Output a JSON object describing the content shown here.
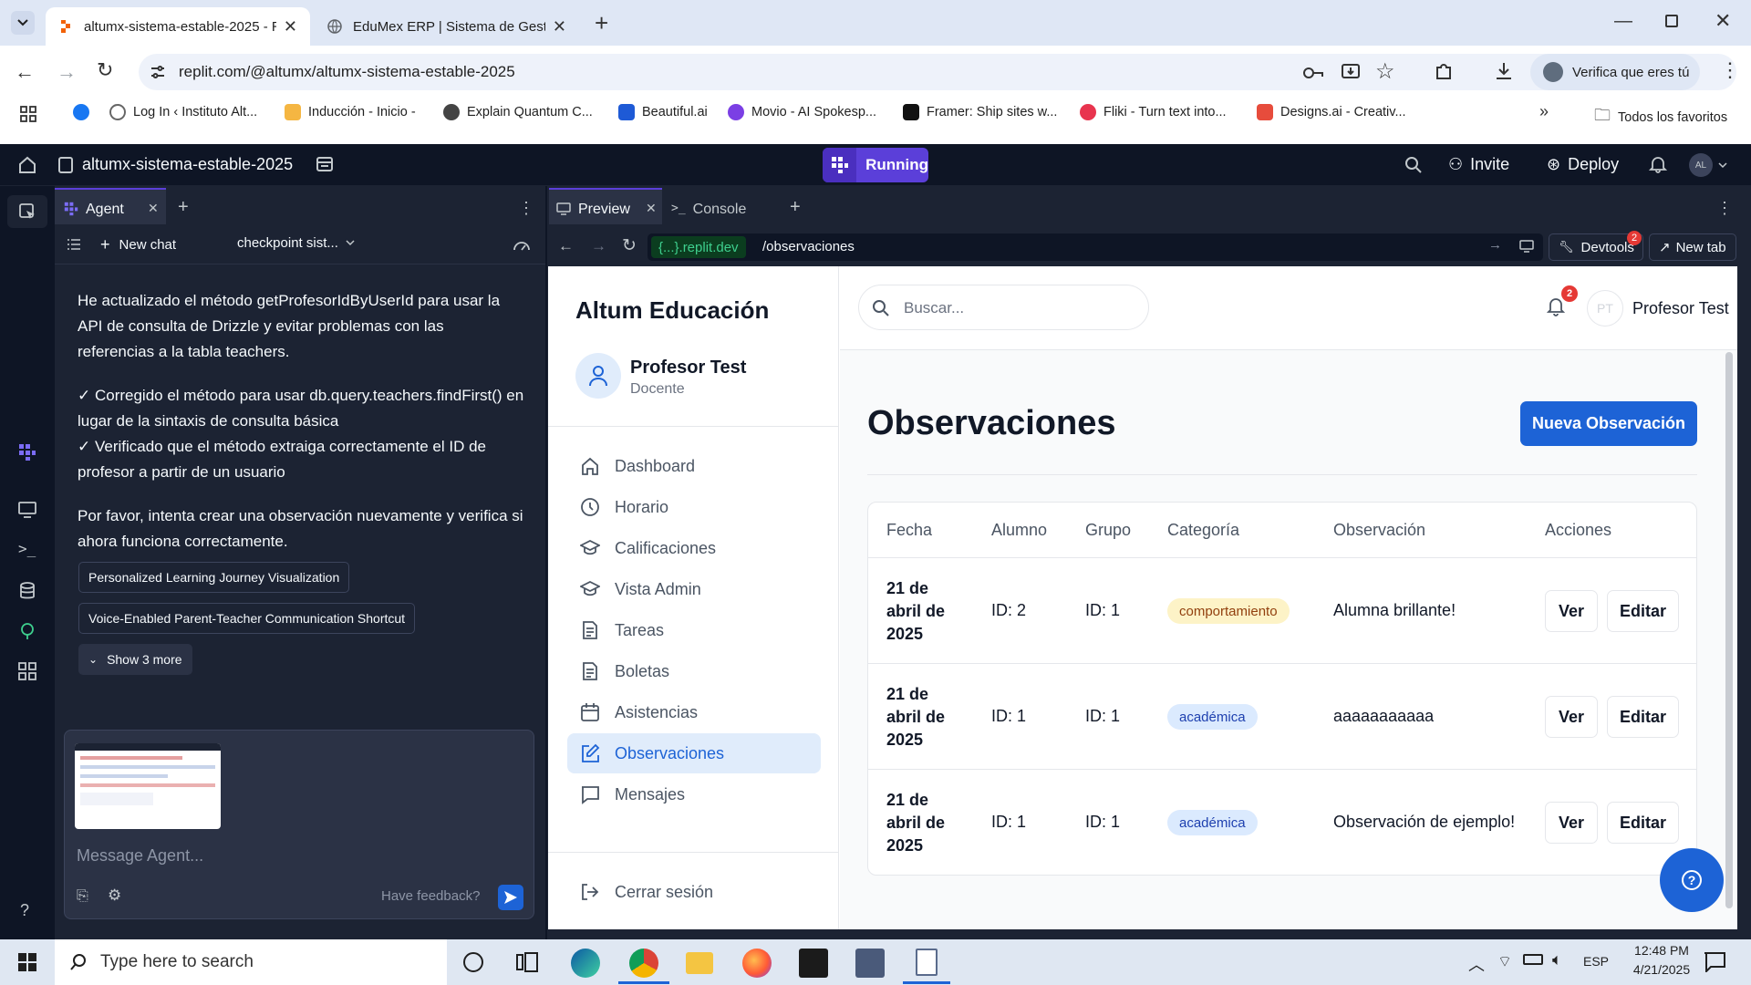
{
  "browser": {
    "tabs": [
      {
        "title": "altumx-sistema-estable-2025 - R",
        "active": true
      },
      {
        "title": "EduMex ERP | Sistema de Gestió",
        "active": false
      }
    ],
    "url": "replit.com/@altumx/altumx-sistema-estable-2025",
    "profile_label": "Verifica que eres tú",
    "bookmarks": [
      "Log In ‹ Instituto Alt...",
      "Inducción - Inicio -",
      "Explain Quantum C...",
      "Beautiful.ai",
      "Movio - AI Spokesp...",
      "Framer: Ship sites w...",
      "Fliki - Turn text into...",
      "Designs.ai - Creativ..."
    ],
    "all_favorites": "Todos los favoritos"
  },
  "replit": {
    "project_name": "altumx-sistema-estable-2025",
    "run_status": "Running",
    "invite_label": "Invite",
    "deploy_label": "Deploy",
    "avatar": "AL"
  },
  "agent": {
    "tab_label": "Agent",
    "new_chat": "New chat",
    "checkpoint": "checkpoint sist...",
    "message_p1": "He actualizado el método getProfesorIdByUserId para usar la API de consulta de Drizzle y evitar problemas con las referencias a la tabla teachers.",
    "message_p2a": "✓ Corregido el método para usar db.query.teachers.findFirst() en lugar de la sintaxis de consulta básica",
    "message_p2b": "✓ Verificado que el método extraiga correctamente el ID de profesor a partir de un usuario",
    "message_p3": "Por favor, intenta crear una observación nuevamente y verifica si ahora funciona correctamente.",
    "suggestions": [
      "Personalized Learning Journey Visualization",
      "Voice-Enabled Parent-Teacher Communication Shortcut"
    ],
    "show_more": "Show 3 more",
    "input_placeholder": "Message Agent...",
    "feedback": "Have feedback?"
  },
  "workspace": {
    "tabs": [
      "Preview",
      "Console"
    ],
    "domain": "{...}.replit.dev",
    "path": "/observaciones",
    "devtools": "Devtools",
    "devtools_badge": "2",
    "new_tab": "New tab"
  },
  "app": {
    "brand": "Altum Educación",
    "user_name": "Profesor Test",
    "user_role": "Docente",
    "search_placeholder": "Buscar...",
    "notif_count": "2",
    "avatar_initials": "PT",
    "nav": [
      {
        "label": "Dashboard",
        "icon": "home-icon"
      },
      {
        "label": "Horario",
        "icon": "clock-icon"
      },
      {
        "label": "Calificaciones",
        "icon": "graduation-cap-icon"
      },
      {
        "label": "Vista Admin",
        "icon": "graduation-cap-icon"
      },
      {
        "label": "Tareas",
        "icon": "document-icon"
      },
      {
        "label": "Boletas",
        "icon": "document-icon"
      },
      {
        "label": "Asistencias",
        "icon": "calendar-icon"
      },
      {
        "label": "Observaciones",
        "icon": "pencil-square-icon",
        "active": true
      },
      {
        "label": "Mensajes",
        "icon": "message-icon"
      }
    ],
    "logout": "Cerrar sesión",
    "page_title": "Observaciones",
    "new_button": "Nueva Observación",
    "table": {
      "headers": [
        "Fecha",
        "Alumno",
        "Grupo",
        "Categoría",
        "Observación",
        "Acciones"
      ],
      "rows": [
        {
          "fecha": "21 de abril de 2025",
          "alumno": "ID: 2",
          "grupo": "ID: 1",
          "categoria": "comportamiento",
          "observacion": "Alumna brillante!"
        },
        {
          "fecha": "21 de abril de 2025",
          "alumno": "ID: 1",
          "grupo": "ID: 1",
          "categoria": "académica",
          "observacion": "aaaaaaaaaaa"
        },
        {
          "fecha": "21 de abril de 2025",
          "alumno": "ID: 1",
          "grupo": "ID: 1",
          "categoria": "académica",
          "observacion": "Observación de ejemplo!"
        }
      ],
      "view_label": "Ver",
      "edit_label": "Editar"
    }
  },
  "taskbar": {
    "search_placeholder": "Type here to search",
    "lang": "ESP",
    "time": "12:48 PM",
    "date": "4/21/2025"
  },
  "colors": {
    "accent": "#1d63d6",
    "replit_bg": "#0e1525",
    "running": "#5b3fd9"
  }
}
